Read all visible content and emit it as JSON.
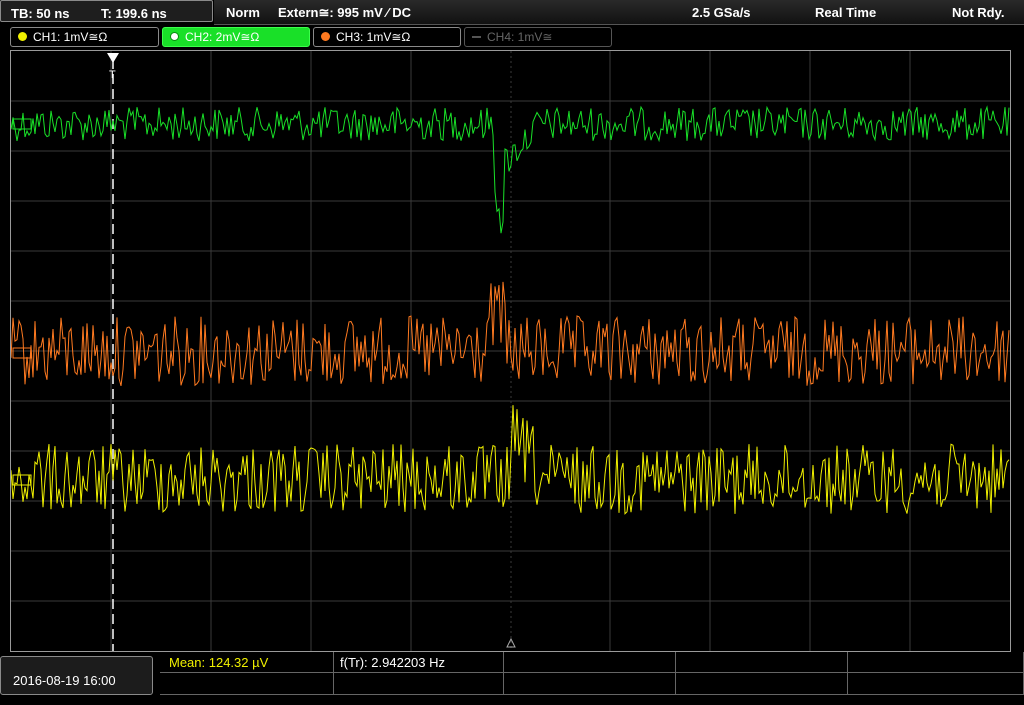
{
  "topbar": {
    "timebase": "TB: 50 ns",
    "trigger_time": "T: 199.6 ns",
    "mode": "Norm",
    "trigger": "Extern≅: 995 mV ⁄ DC",
    "sample_rate": "2.5 GSa/s",
    "acq_mode": "Real Time",
    "status": "Not Rdy."
  },
  "channels": [
    {
      "label": "CH1: 1mV≅Ω",
      "color": "#f0f000",
      "state": "on"
    },
    {
      "label": "CH2: 2mV≅Ω",
      "color": "#19e028",
      "state": "active"
    },
    {
      "label": "CH3: 1mV≅Ω",
      "color": "#ff7a20",
      "state": "on"
    },
    {
      "label": "CH4: 1mV≅",
      "color": "#666666",
      "state": "off"
    }
  ],
  "waveforms": {
    "ch2_color": "#19e028",
    "ch3_color": "#ff7a20",
    "ch1_color": "#f0f000"
  },
  "footer": {
    "datetime": "2016-08-19 16:00",
    "mean": "Mean: 124.32 µV",
    "freq": "f(Tr): 2.942203 Hz"
  }
}
